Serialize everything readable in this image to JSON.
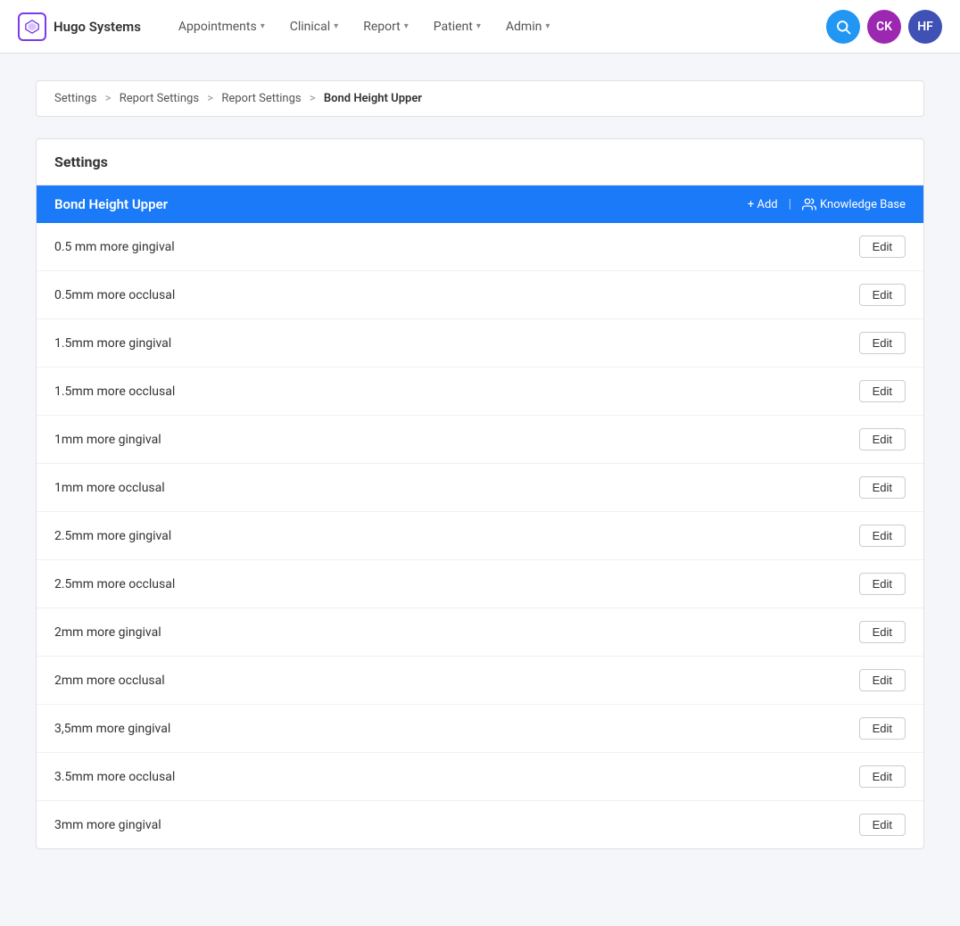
{
  "logo": {
    "text": "Hugo Systems"
  },
  "nav": {
    "items": [
      {
        "label": "Appointments",
        "id": "appointments"
      },
      {
        "label": "Clinical",
        "id": "clinical"
      },
      {
        "label": "Report",
        "id": "report"
      },
      {
        "label": "Patient",
        "id": "patient"
      },
      {
        "label": "Admin",
        "id": "admin"
      }
    ]
  },
  "navbar_right": {
    "search_icon": "🔍",
    "user1_initials": "CK",
    "user2_initials": "HF"
  },
  "breadcrumb": {
    "parts": [
      {
        "label": "Settings",
        "link": true
      },
      {
        "label": "Report Settings",
        "link": true
      },
      {
        "label": "Report Settings",
        "link": true
      },
      {
        "label": "Bond Height Upper",
        "link": false
      }
    ],
    "separator": ">"
  },
  "settings": {
    "section_title": "Settings",
    "header_title": "Bond Height Upper",
    "add_label": "+ Add",
    "separator": "|",
    "knowledge_base_label": "Knowledge Base",
    "edit_label": "Edit",
    "items": [
      {
        "id": 1,
        "label": "0.5 mm more gingival"
      },
      {
        "id": 2,
        "label": "0.5mm more occlusal"
      },
      {
        "id": 3,
        "label": "1.5mm more gingival"
      },
      {
        "id": 4,
        "label": "1.5mm more occlusal"
      },
      {
        "id": 5,
        "label": "1mm more gingival"
      },
      {
        "id": 6,
        "label": "1mm more occlusal"
      },
      {
        "id": 7,
        "label": "2.5mm more gingival"
      },
      {
        "id": 8,
        "label": "2.5mm more occlusal"
      },
      {
        "id": 9,
        "label": "2mm more gingival"
      },
      {
        "id": 10,
        "label": "2mm more occlusal"
      },
      {
        "id": 11,
        "label": "3,5mm more gingival"
      },
      {
        "id": 12,
        "label": "3.5mm more occlusal"
      },
      {
        "id": 13,
        "label": "3mm more gingival"
      }
    ]
  }
}
